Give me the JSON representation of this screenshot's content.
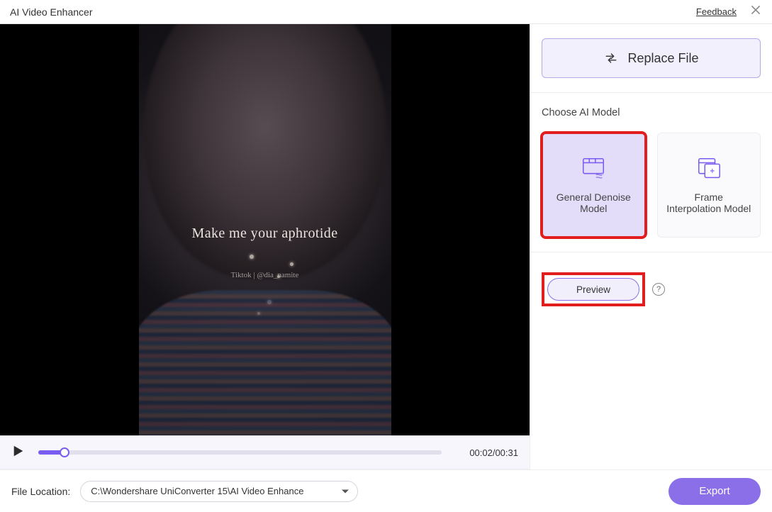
{
  "titlebar": {
    "title": "AI Video Enhancer",
    "feedback": "Feedback"
  },
  "video": {
    "overlay_text": "Make me your aphrotide",
    "watermark": "Tiktok | @dia_namite"
  },
  "playback": {
    "time": "00:02/00:31"
  },
  "side": {
    "replace_label": "Replace File",
    "choose_model_label": "Choose AI Model",
    "models": [
      {
        "label": "General Denoise Model"
      },
      {
        "label": "Frame Interpolation Model"
      }
    ],
    "preview_label": "Preview",
    "help_glyph": "?"
  },
  "footer": {
    "file_location_label": "File Location:",
    "file_location_value": "C:\\Wondershare UniConverter 15\\AI Video Enhance",
    "export_label": "Export"
  }
}
